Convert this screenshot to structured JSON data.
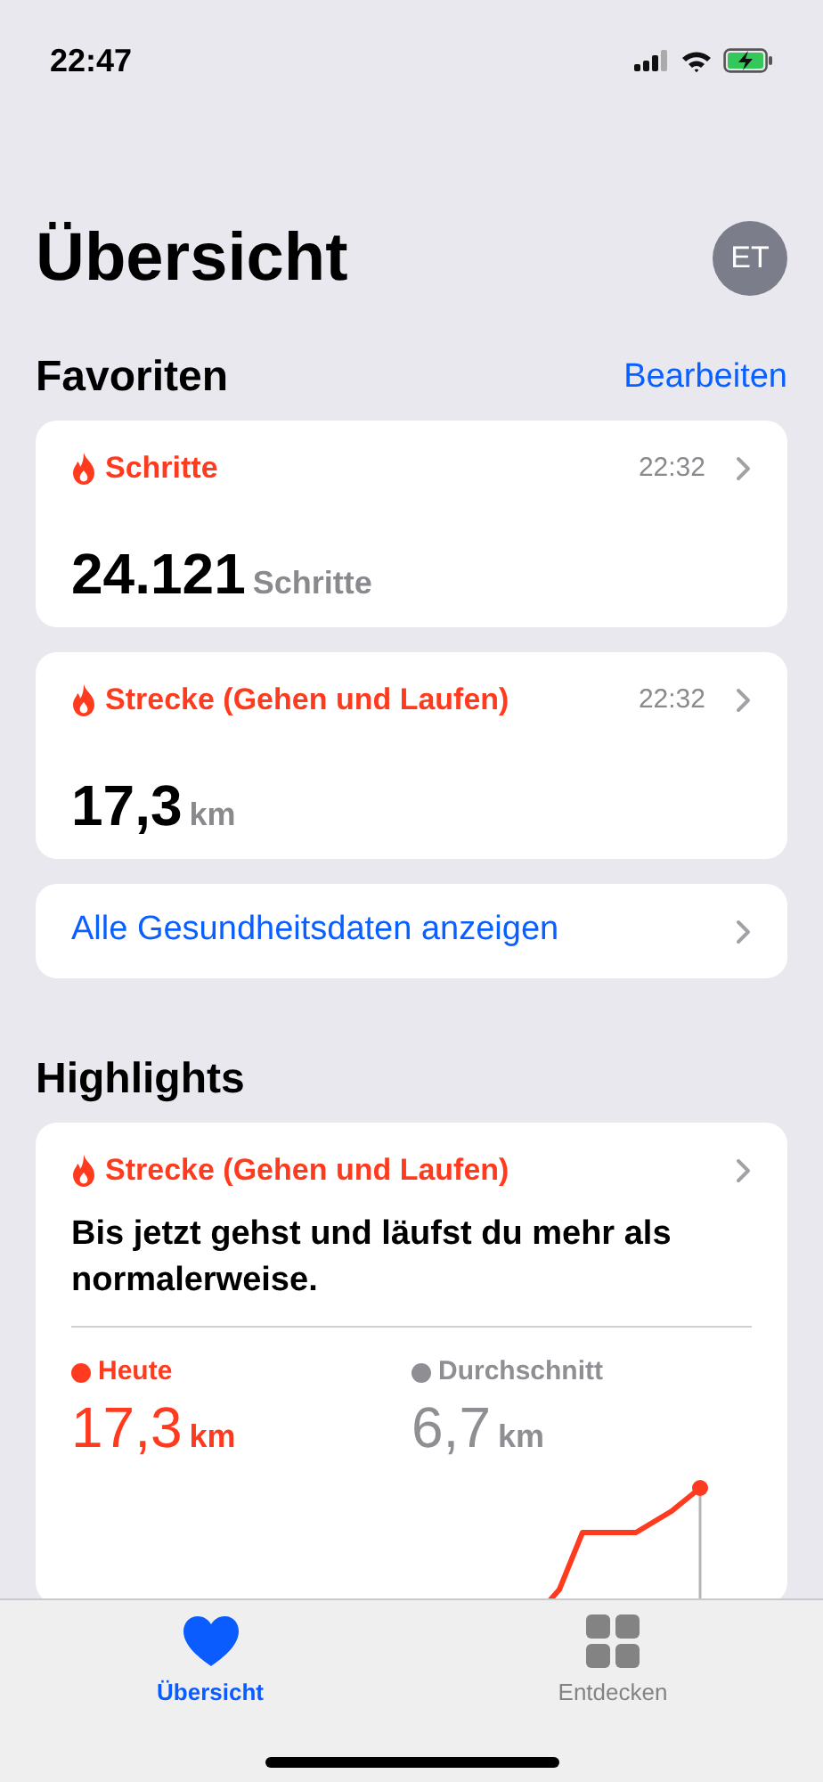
{
  "status_bar": {
    "time": "22:47"
  },
  "title": "Übersicht",
  "avatar": {
    "initials": "ET"
  },
  "favorites": {
    "title": "Favoriten",
    "edit": "Bearbeiten",
    "items": [
      {
        "label": "Schritte",
        "time": "22:32",
        "value": "24.121",
        "unit": "Schritte"
      },
      {
        "label": "Strecke (Gehen und Laufen)",
        "time": "22:32",
        "value": "17,3",
        "unit": "km"
      }
    ],
    "all_data": "Alle Gesundheitsdaten anzeigen"
  },
  "highlights": {
    "title": "Highlights",
    "card": {
      "label": "Strecke (Gehen und Laufen)",
      "message": "Bis jetzt gehst und läufst du mehr als normalerweise.",
      "stats": [
        {
          "label": "Heute",
          "value": "17,3",
          "unit": "km",
          "color": "#ff3b1f"
        },
        {
          "label": "Durchschnitt",
          "value": "6,7",
          "unit": "km",
          "color": "#8e8e93"
        }
      ]
    }
  },
  "tabs": [
    {
      "label": "Übersicht",
      "kind": "heart",
      "selected": true
    },
    {
      "label": "Entdecken",
      "kind": "grid",
      "selected": false
    }
  ]
}
